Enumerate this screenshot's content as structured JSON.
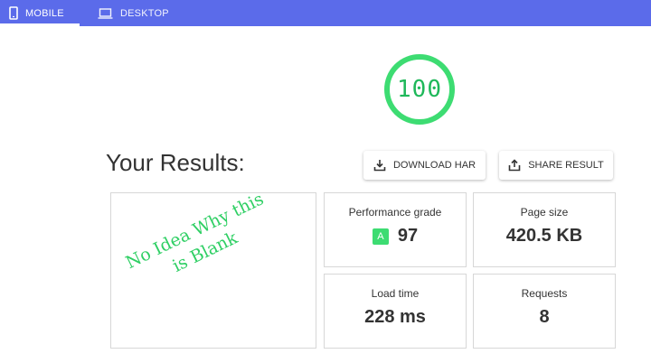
{
  "tabs": [
    {
      "label": "MOBILE",
      "icon": "mobile-phone-icon",
      "active": true
    },
    {
      "label": "DESKTOP",
      "icon": "laptop-icon",
      "active": false
    }
  ],
  "score": {
    "value": "100",
    "color": "#3ddc72"
  },
  "results": {
    "title": "Your Results:"
  },
  "buttons": {
    "download_har": {
      "label": "DOWNLOAD HAR",
      "icon": "download-icon"
    },
    "share_result": {
      "label": "SHARE RESULT",
      "icon": "share-icon"
    }
  },
  "annotation": {
    "line1": "No Idea Why this",
    "line2": "is Blank",
    "color": "#2fcf64"
  },
  "metrics": {
    "performance": {
      "label": "Performance grade",
      "grade": "A",
      "value": "97"
    },
    "page_size": {
      "label": "Page size",
      "value": "420.5 KB"
    },
    "load_time": {
      "label": "Load time",
      "value": "228 ms"
    },
    "requests": {
      "label": "Requests",
      "value": "8"
    }
  },
  "colors": {
    "tabbar": "#5b6bea",
    "accent_green": "#3ddc72"
  }
}
